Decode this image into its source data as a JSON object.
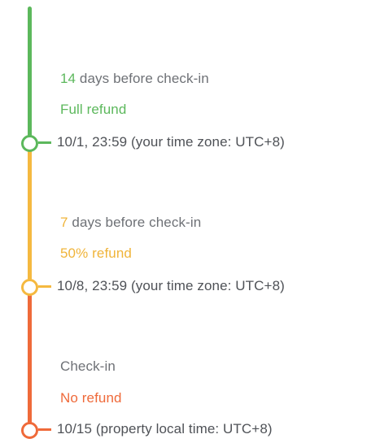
{
  "colors": {
    "green": "#5cb85c",
    "yellow": "#f5b940",
    "red": "#ef6a3a",
    "text": "#5a5d63"
  },
  "stages": [
    {
      "count": "14",
      "when_rest": " days before check-in",
      "refund": "Full refund",
      "deadline": "10/1, 23:59 (your time zone: UTC+8)"
    },
    {
      "count": "7",
      "when_rest": " days before check-in",
      "refund": "50% refund",
      "deadline": "10/8, 23:59 (your time zone: UTC+8)"
    },
    {
      "when": "Check-in",
      "refund": "No refund",
      "deadline": "10/15 (property local time: UTC+8)"
    }
  ]
}
